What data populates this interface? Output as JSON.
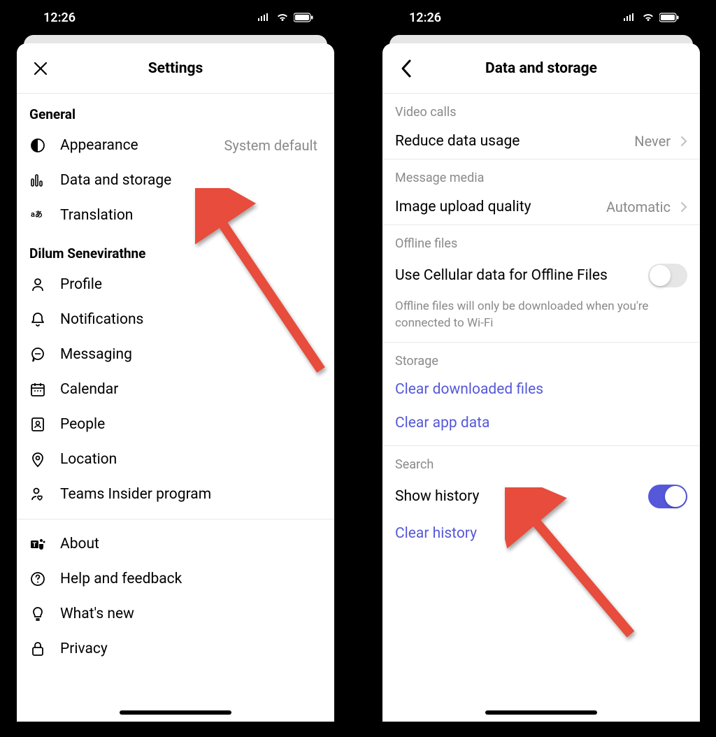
{
  "status": {
    "time": "12:26"
  },
  "left": {
    "title": "Settings",
    "sections": [
      {
        "header": "General",
        "items": [
          {
            "icon": "half-circle",
            "label": "Appearance",
            "value": "System default"
          },
          {
            "icon": "bars",
            "label": "Data and storage"
          },
          {
            "icon": "lang",
            "label": "Translation"
          }
        ]
      },
      {
        "header": "Dilum Senevirathne",
        "items": [
          {
            "icon": "profile",
            "label": "Profile"
          },
          {
            "icon": "bell",
            "label": "Notifications"
          },
          {
            "icon": "chat",
            "label": "Messaging"
          },
          {
            "icon": "calendar",
            "label": "Calendar"
          },
          {
            "icon": "people",
            "label": "People"
          },
          {
            "icon": "location",
            "label": "Location"
          },
          {
            "icon": "insider",
            "label": "Teams Insider program"
          }
        ]
      },
      {
        "header": null,
        "items": [
          {
            "icon": "teams",
            "label": "About"
          },
          {
            "icon": "help",
            "label": "Help and feedback"
          },
          {
            "icon": "bulb",
            "label": "What's new"
          },
          {
            "icon": "lock",
            "label": "Privacy"
          }
        ]
      }
    ]
  },
  "right": {
    "title": "Data and storage",
    "groups": {
      "video": {
        "header": "Video calls",
        "item": {
          "label": "Reduce data usage",
          "value": "Never"
        }
      },
      "media": {
        "header": "Message media",
        "item": {
          "label": "Image upload quality",
          "value": "Automatic"
        }
      },
      "offline": {
        "header": "Offline files",
        "item": {
          "label": "Use Cellular data for Offline Files"
        },
        "footnote": "Offline files will only be downloaded when you're connected to Wi-Fi"
      },
      "storage": {
        "header": "Storage",
        "links": [
          "Clear downloaded files",
          "Clear app data"
        ]
      },
      "search": {
        "header": "Search",
        "item": {
          "label": "Show history"
        },
        "link": "Clear history"
      }
    }
  }
}
